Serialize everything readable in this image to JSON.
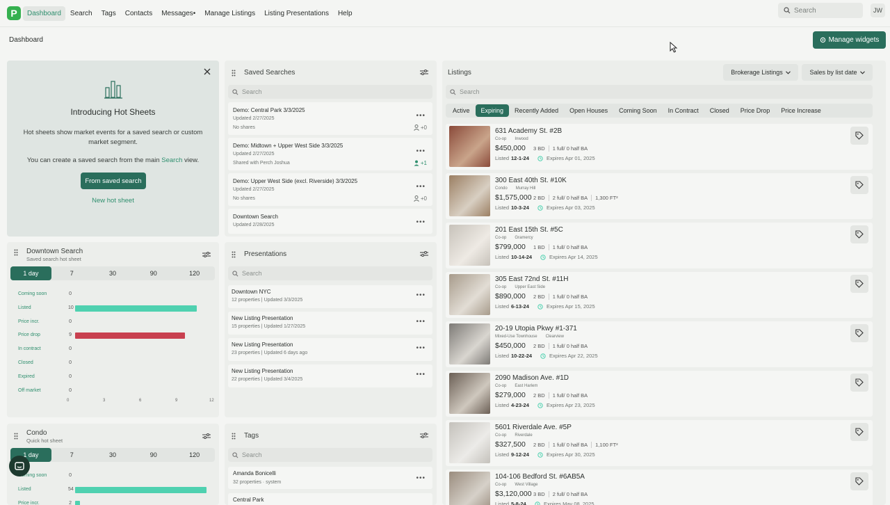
{
  "nav": {
    "logo": "P",
    "items": [
      "Dashboard",
      "Search",
      "Tags",
      "Contacts",
      "Messages•",
      "Manage Listings",
      "Listing Presentations",
      "Help"
    ],
    "search_placeholder": "Search",
    "avatar": "JW"
  },
  "breadcrumb": "Dashboard",
  "manage_widgets": "Manage widgets",
  "hot_sheets": {
    "title": "Introducing Hot Sheets",
    "desc": "Hot sheets show market events for a saved search or custom market segment.",
    "desc2_pre": "You can create a saved search from the main",
    "desc2_link": "Search",
    "desc2_post": "view.",
    "btn_primary": "From saved search",
    "btn_secondary": "New hot sheet"
  },
  "saved_searches": {
    "title": "Saved Searches",
    "search_placeholder": "Search",
    "items": [
      {
        "title": "Demo: Central Park 3/3/2025",
        "updated": "Updated 2/27/2025",
        "share": "No shares",
        "count": "+0"
      },
      {
        "title": "Demo: Midtown + Upper West Side 3/3/2025",
        "updated": "Updated 2/27/2025",
        "share": "Shared with Perch Joshua",
        "count": "+1"
      },
      {
        "title": "Demo: Upper West Side (excl. Riverside) 3/3/2025",
        "updated": "Updated 2/27/2025",
        "share": "No shares",
        "count": "+0"
      },
      {
        "title": "Downtown Search",
        "updated": "Updated 2/28/2025",
        "share": "",
        "count": ""
      }
    ]
  },
  "downtown": {
    "title": "Downtown Search",
    "subtitle": "Saved search hot sheet",
    "periods": [
      "1 day",
      "7",
      "30",
      "90",
      "120"
    ],
    "rows": [
      {
        "label": "Coming soon",
        "value": 0
      },
      {
        "label": "Listed",
        "value": 10
      },
      {
        "label": "Price incr.",
        "value": 0
      },
      {
        "label": "Price drop",
        "value": 9
      },
      {
        "label": "In contract",
        "value": 0
      },
      {
        "label": "Closed",
        "value": 0
      },
      {
        "label": "Expired",
        "value": 0
      },
      {
        "label": "Off market",
        "value": 0
      }
    ],
    "axis": [
      "0",
      "3",
      "6",
      "9",
      "12"
    ]
  },
  "condo": {
    "title": "Condo",
    "subtitle": "Quick hot sheet",
    "periods": [
      "1 day",
      "7",
      "30",
      "90",
      "120"
    ],
    "rows": [
      {
        "label": "Coming soon",
        "value": 0
      },
      {
        "label": "Listed",
        "value": 54
      },
      {
        "label": "Price incr.",
        "value": 2
      }
    ]
  },
  "presentations": {
    "title": "Presentations",
    "search_placeholder": "Search",
    "items": [
      {
        "title": "Downtown NYC",
        "count": "12 properties",
        "updated": "Updated 3/3/2025"
      },
      {
        "title": "New Listing Presentation",
        "count": "15 properties",
        "updated": "Updated 1/27/2025"
      },
      {
        "title": "New Listing Presentation",
        "count": "23 properties",
        "updated": "Updated 6 days ago"
      },
      {
        "title": "New Listing Presentation",
        "count": "22 properties",
        "updated": "Updated 3/4/2025"
      }
    ]
  },
  "tags": {
    "title": "Tags",
    "search_placeholder": "Search",
    "items": [
      {
        "title": "Amanda Bonicelli",
        "count": "32 properties",
        "kind": "system"
      },
      {
        "title": "Central Park",
        "count": "",
        "kind": ""
      }
    ]
  },
  "listings": {
    "title": "Listings",
    "dropdown1": "Brokerage Listings",
    "dropdown2": "Sales by list date",
    "search_placeholder": "Search",
    "tabs": [
      "Active",
      "Expiring",
      "Recently Added",
      "Open Houses",
      "Coming Soon",
      "In Contract",
      "Closed",
      "Price Drop",
      "Price Increase"
    ],
    "active_tab": "Expiring",
    "items": [
      {
        "addr": "631 Academy St. #2B",
        "type": "Co-op",
        "hood": "Inwood",
        "price": "$450,000",
        "beds": "3 BD",
        "baths": "1 full/ 0 half BA",
        "sqft": "",
        "listed": "12-1-24",
        "expires": "Expires Apr 01, 2025"
      },
      {
        "addr": "300 East 40th St. #10K",
        "type": "Condo",
        "hood": "Murray Hill",
        "price": "$1,575,000",
        "beds": "2 BD",
        "baths": "2 full/ 0 half BA",
        "sqft": "1,300 FT²",
        "listed": "10-3-24",
        "expires": "Expires Apr 03, 2025"
      },
      {
        "addr": "201 East 15th St. #5C",
        "type": "Co-op",
        "hood": "Gramercy",
        "price": "$799,000",
        "beds": "1 BD",
        "baths": "1 full/ 0 half BA",
        "sqft": "",
        "listed": "10-14-24",
        "expires": "Expires Apr 14, 2025"
      },
      {
        "addr": "305 East 72nd St. #11H",
        "type": "Co-op",
        "hood": "Upper East Side",
        "price": "$890,000",
        "beds": "2 BD",
        "baths": "1 full/ 0 half BA",
        "sqft": "",
        "listed": "6-13-24",
        "expires": "Expires Apr 15, 2025"
      },
      {
        "addr": "20-19 Utopia Pkwy #1-371",
        "type": "Mixed-Use Townhouse",
        "hood": "Clearview",
        "price": "$450,000",
        "beds": "2 BD",
        "baths": "1 full/ 0 half BA",
        "sqft": "",
        "listed": "10-22-24",
        "expires": "Expires Apr 22, 2025"
      },
      {
        "addr": "2090 Madison Ave. #1D",
        "type": "Co-op",
        "hood": "East Harlem",
        "price": "$279,000",
        "beds": "2 BD",
        "baths": "1 full/ 0 half BA",
        "sqft": "",
        "listed": "4-23-24",
        "expires": "Expires Apr 23, 2025"
      },
      {
        "addr": "5601 Riverdale Ave. #5P",
        "type": "Co-op",
        "hood": "Riverdale",
        "price": "$327,500",
        "beds": "2 BD",
        "baths": "1 full/ 0 half BA",
        "sqft": "1,100 FT²",
        "listed": "9-12-24",
        "expires": "Expires Apr 30, 2025"
      },
      {
        "addr": "104-106 Bedford St. #6AB5A",
        "type": "Co-op",
        "hood": "West Village",
        "price": "$3,120,000",
        "beds": "3 BD",
        "baths": "2 full/ 0 half BA",
        "sqft": "",
        "listed": "5-8-24",
        "expires": "Expires May 08, 2025"
      }
    ],
    "listed_label": "Listed"
  },
  "colors": {
    "accent": "#2a6e5c",
    "teal_bar": "#4fd1b0",
    "red_bar": "#c8404f",
    "logo": "#35b04f"
  }
}
